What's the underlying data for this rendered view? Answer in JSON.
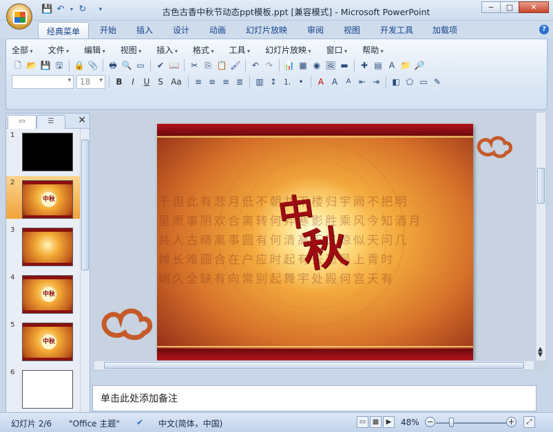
{
  "window": {
    "title": "古色古香中秋节动态ppt模板.ppt [兼容模式] - Microsoft PowerPoint",
    "minimize": "−",
    "maximize": "□",
    "close": "✕"
  },
  "ribbon_tabs": [
    "经典菜单",
    "开始",
    "插入",
    "设计",
    "动画",
    "幻灯片放映",
    "审阅",
    "视图",
    "开发工具",
    "加载项"
  ],
  "menu": [
    "全部",
    "文件",
    "编辑",
    "视图",
    "插入",
    "格式",
    "工具",
    "幻灯片放映",
    "窗口",
    "帮助"
  ],
  "format_bar": {
    "font_name": "",
    "font_size": "18",
    "bold": "B",
    "italic": "I",
    "underline": "U",
    "shadow": "S",
    "change_case": "Aa"
  },
  "slides": [
    {
      "num": "1",
      "kind": "black"
    },
    {
      "num": "2",
      "kind": "gold",
      "selected": true,
      "mark": "中秋"
    },
    {
      "num": "3",
      "kind": "gold"
    },
    {
      "num": "4",
      "kind": "gold",
      "mark": "中秋"
    },
    {
      "num": "5",
      "kind": "gold",
      "mark": "中秋"
    },
    {
      "num": "6",
      "kind": "white"
    }
  ],
  "slide_content": {
    "poem_lines": [
      "千但此有悲月低不朝并下楼归宇阙不把明",
      "里愿事阴欢合离转何弄寒影胜乘风今知酒月",
      "共人古晴离事圆有何清高玉又琼似天问几",
      "婵长难圆合在户应时起有去恐是上青时",
      "娟久全缺有向常别起舞宇处殿何宫天有"
    ],
    "title_chars": [
      "中",
      "秋"
    ]
  },
  "notes_placeholder": "单击此处添加备注",
  "status": {
    "slide_indicator": "幻灯片 2/6",
    "theme": "\"Office 主题\"",
    "language": "中文(简体，中国)",
    "zoom": "48%"
  }
}
